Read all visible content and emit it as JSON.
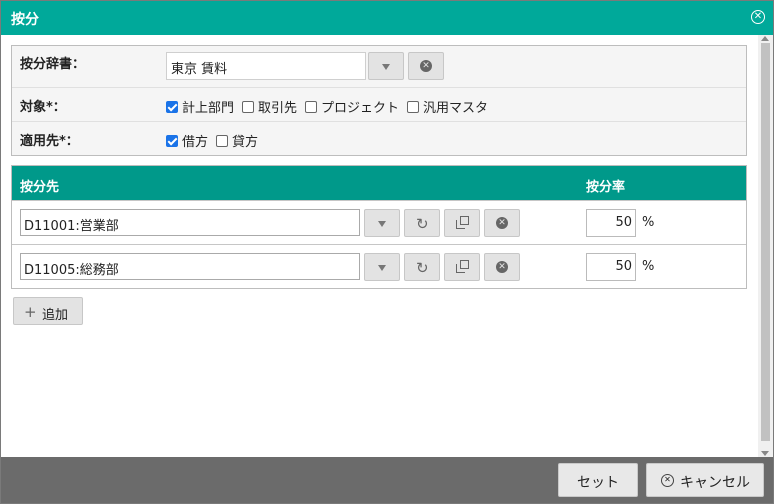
{
  "dialog": {
    "title": "按分"
  },
  "form": {
    "dictionary": {
      "label": "按分辞書：",
      "value": "東京 賃料"
    },
    "target": {
      "label": "対象*：",
      "options": [
        {
          "label": "計上部門",
          "checked": true
        },
        {
          "label": "取引先",
          "checked": false
        },
        {
          "label": "プロジェクト",
          "checked": false
        },
        {
          "label": "汎用マスタ",
          "checked": false
        }
      ]
    },
    "apply_to": {
      "label": "適用先*：",
      "options": [
        {
          "label": "借方",
          "checked": true
        },
        {
          "label": "貸方",
          "checked": false
        }
      ]
    }
  },
  "grid": {
    "headers": {
      "destination": "按分先",
      "rate": "按分率"
    },
    "rows": [
      {
        "destination": "D11001:営業部",
        "rate": "50",
        "unit": "%"
      },
      {
        "destination": "D11005:総務部",
        "rate": "50",
        "unit": "%"
      }
    ]
  },
  "actions": {
    "add_label": "追加",
    "set_label": "セット",
    "cancel_label": "キャンセル"
  },
  "colors": {
    "titlebar": "#00a99a",
    "grid_header": "#00998a",
    "footer": "#6b6b6b",
    "checkbox_checked": "#1a73e8"
  }
}
